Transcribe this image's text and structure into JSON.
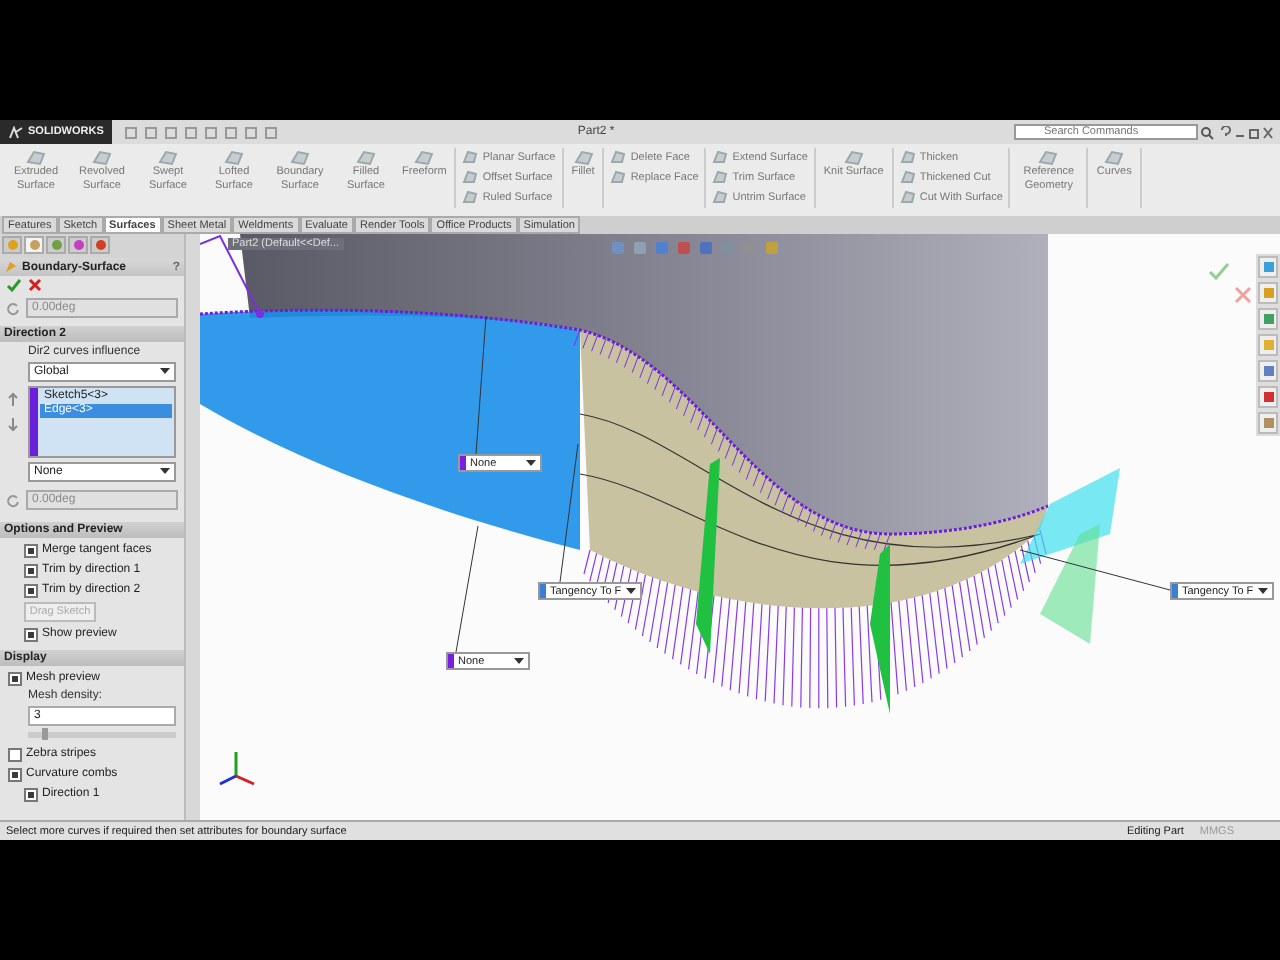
{
  "window": {
    "title": "Part2 *",
    "logo": "SOLIDWORKS"
  },
  "search": {
    "placeholder": "Search Commands"
  },
  "ribbon": [
    {
      "kind": "large",
      "label": "Extruded Surface"
    },
    {
      "kind": "large",
      "label": "Revolved Surface"
    },
    {
      "kind": "large",
      "label": "Swept Surface"
    },
    {
      "kind": "large",
      "label": "Lofted Surface"
    },
    {
      "kind": "large",
      "label": "Boundary Surface"
    },
    {
      "kind": "large",
      "label": "Filled Surface"
    },
    {
      "kind": "large",
      "label": "Freeform"
    },
    {
      "kind": "stack",
      "items": [
        "Planar Surface",
        "Offset Surface",
        "Ruled Surface"
      ]
    },
    {
      "kind": "large",
      "label": "Fillet"
    },
    {
      "kind": "stack",
      "items": [
        "Delete Face",
        "Replace Face"
      ]
    },
    {
      "kind": "stack",
      "items": [
        "Extend Surface",
        "Trim Surface",
        "Untrim Surface"
      ]
    },
    {
      "kind": "large",
      "label": "Knit Surface"
    },
    {
      "kind": "stack",
      "items": [
        "Thicken",
        "Thickened Cut",
        "Cut With Surface"
      ]
    },
    {
      "kind": "large",
      "label": "Reference Geometry"
    },
    {
      "kind": "large",
      "label": "Curves"
    }
  ],
  "tabs": [
    {
      "label": "Features",
      "selected": false
    },
    {
      "label": "Sketch",
      "selected": false
    },
    {
      "label": "Surfaces",
      "selected": true
    },
    {
      "label": "Sheet Metal",
      "selected": false
    },
    {
      "label": "Weldments",
      "selected": false
    },
    {
      "label": "Evaluate",
      "selected": false
    },
    {
      "label": "Render Tools",
      "selected": false
    },
    {
      "label": "Office Products",
      "selected": false
    },
    {
      "label": "Simulation",
      "selected": false
    }
  ],
  "property_manager": {
    "tabs": [
      {
        "selected": false
      },
      {
        "selected": true
      },
      {
        "selected": false
      },
      {
        "selected": false
      },
      {
        "selected": false
      }
    ],
    "title": "Boundary-Surface",
    "help": "?",
    "angle": "0.00deg",
    "direction_2": {
      "title": "Direction 2",
      "influence_label": "Dir2 curves influence",
      "influence": "Global",
      "curves": [
        {
          "label": "Sketch5<3>",
          "selected": false
        },
        {
          "label": "Edge<3>",
          "selected": true
        }
      ],
      "tangency": "None",
      "angle": "0.00deg"
    },
    "options": {
      "title": "Options and Preview",
      "checks": [
        {
          "label": "Merge tangent faces",
          "checked": true
        },
        {
          "label": "Trim by direction 1",
          "checked": true
        },
        {
          "label": "Trim by direction 2",
          "checked": true
        }
      ],
      "button": {
        "label": "Drag Sketch",
        "disabled": true
      },
      "show_preview": {
        "label": "Show preview",
        "checked": true
      }
    },
    "display": {
      "title": "Display",
      "mesh_preview": {
        "label": "Mesh preview",
        "checked": true
      },
      "density_label": "Mesh density:",
      "density": "3",
      "density_slider": {
        "level": 0.1
      },
      "checks": [
        {
          "label": "Zebra stripes",
          "checked": false
        },
        {
          "label": "Curvature combs",
          "checked": true,
          "children": [
            {
              "label": "Direction 1",
              "checked": true
            }
          ]
        }
      ]
    }
  },
  "viewport": {
    "breadcrumb": "Part2 (Default<<Def...",
    "callouts": [
      {
        "label": "None",
        "color": "#7a1fe0"
      },
      {
        "label": "None",
        "color": "#7a1fe0"
      },
      {
        "label": "Tangency To F",
        "color": "#3a7fd5"
      },
      {
        "label": "Tangency To F",
        "color": "#3a7fd5"
      }
    ]
  },
  "status_bar": {
    "message": "Select more curves if required then set attributes for boundary surface",
    "mode": "Editing Part",
    "units": "MMGS"
  }
}
